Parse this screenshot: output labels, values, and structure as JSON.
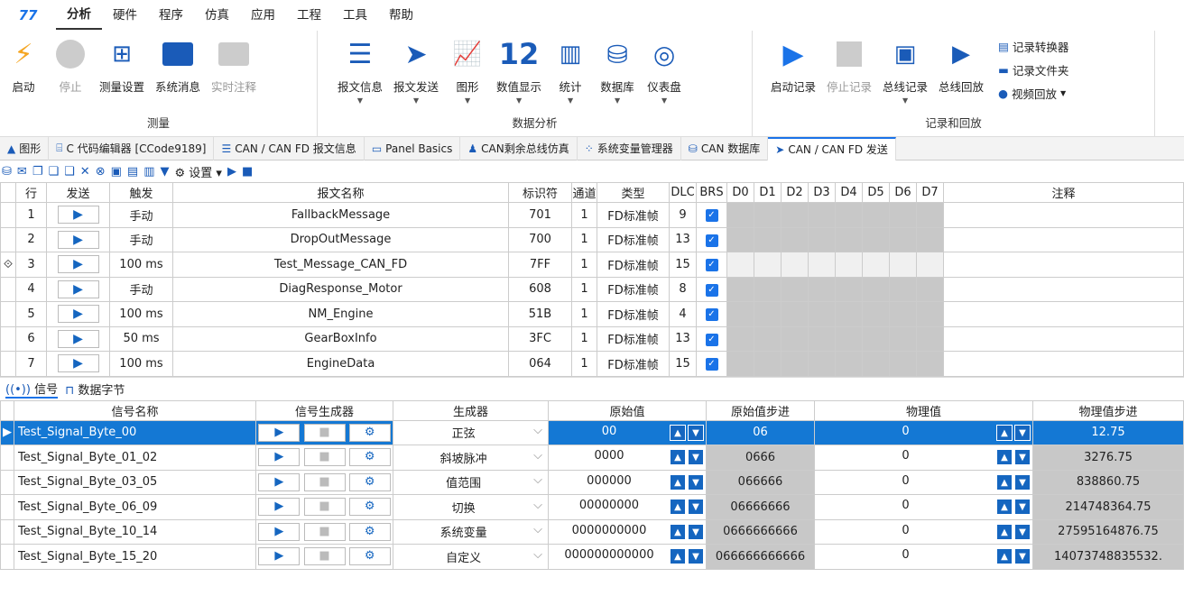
{
  "menu": {
    "logo": "77",
    "items": [
      "分析",
      "硬件",
      "程序",
      "仿真",
      "应用",
      "工程",
      "工具",
      "帮助"
    ]
  },
  "ribbon": {
    "measure": {
      "label": "测量",
      "buttons": [
        "启动",
        "停止",
        "测量设置",
        "系统消息",
        "实时注释"
      ]
    },
    "analysis": {
      "label": "数据分析",
      "buttons": [
        "报文信息",
        "报文发送",
        "图形",
        "数值显示",
        "统计",
        "数据库",
        "仪表盘"
      ],
      "number_icon": "12"
    },
    "record": {
      "label": "记录和回放",
      "buttons": [
        "启动记录",
        "停止记录",
        "总线记录",
        "总线回放"
      ],
      "side": [
        "记录转换器",
        "记录文件夹",
        "视频回放"
      ]
    }
  },
  "tabs": [
    "图形",
    "C 代码编辑器 [CCode9189]",
    "CAN / CAN FD 报文信息",
    "Panel Basics",
    "CAN剩余总线仿真",
    "系统变量管理器",
    "CAN 数据库",
    "CAN / CAN FD 发送"
  ],
  "toolbar2": {
    "settings": "设置"
  },
  "msg_table": {
    "headers": [
      "行",
      "发送",
      "触发",
      "报文名称",
      "标识符",
      "通道",
      "类型",
      "DLC",
      "BRS",
      "D0",
      "D1",
      "D2",
      "D3",
      "D4",
      "D5",
      "D6",
      "D7",
      "注释"
    ],
    "rows": [
      {
        "row": "1",
        "trigger": "手动",
        "name": "FallbackMessage",
        "id": "701",
        "ch": "1",
        "type": "FD标准帧",
        "dlc": "9"
      },
      {
        "row": "2",
        "trigger": "手动",
        "name": "DropOutMessage",
        "id": "700",
        "ch": "1",
        "type": "FD标准帧",
        "dlc": "13"
      },
      {
        "row": "3",
        "trigger": "100 ms",
        "name": "Test_Message_CAN_FD",
        "id": "7FF",
        "ch": "1",
        "type": "FD标准帧",
        "dlc": "15"
      },
      {
        "row": "4",
        "trigger": "手动",
        "name": "DiagResponse_Motor",
        "id": "608",
        "ch": "1",
        "type": "FD标准帧",
        "dlc": "8"
      },
      {
        "row": "5",
        "trigger": "100 ms",
        "name": "NM_Engine",
        "id": "51B",
        "ch": "1",
        "type": "FD标准帧",
        "dlc": "4"
      },
      {
        "row": "6",
        "trigger": "50 ms",
        "name": "GearBoxInfo",
        "id": "3FC",
        "ch": "1",
        "type": "FD标准帧",
        "dlc": "13"
      },
      {
        "row": "7",
        "trigger": "100 ms",
        "name": "EngineData",
        "id": "064",
        "ch": "1",
        "type": "FD标准帧",
        "dlc": "15"
      }
    ]
  },
  "subtabs": [
    "信号",
    "数据字节"
  ],
  "sig_table": {
    "headers": [
      "信号名称",
      "信号生成器",
      "生成器",
      "原始值",
      "原始值步进",
      "物理值",
      "物理值步进"
    ],
    "rows": [
      {
        "name": "Test_Signal_Byte_00",
        "gen": "正弦",
        "raw": "00",
        "rawstep": "06",
        "phys": "0",
        "physstep": "12.75"
      },
      {
        "name": "Test_Signal_Byte_01_02",
        "gen": "斜坡脉冲",
        "raw": "0000",
        "rawstep": "0666",
        "phys": "0",
        "physstep": "3276.75"
      },
      {
        "name": "Test_Signal_Byte_03_05",
        "gen": "值范围",
        "raw": "000000",
        "rawstep": "066666",
        "phys": "0",
        "physstep": "838860.75"
      },
      {
        "name": "Test_Signal_Byte_06_09",
        "gen": "切换",
        "raw": "00000000",
        "rawstep": "06666666",
        "phys": "0",
        "physstep": "214748364.75"
      },
      {
        "name": "Test_Signal_Byte_10_14",
        "gen": "系统变量",
        "raw": "0000000000",
        "rawstep": "0666666666",
        "phys": "0",
        "physstep": "27595164876.75"
      },
      {
        "name": "Test_Signal_Byte_15_20",
        "gen": "自定义",
        "raw": "000000000000",
        "rawstep": "066666666666",
        "phys": "0",
        "physstep": "14073748835532."
      }
    ]
  }
}
